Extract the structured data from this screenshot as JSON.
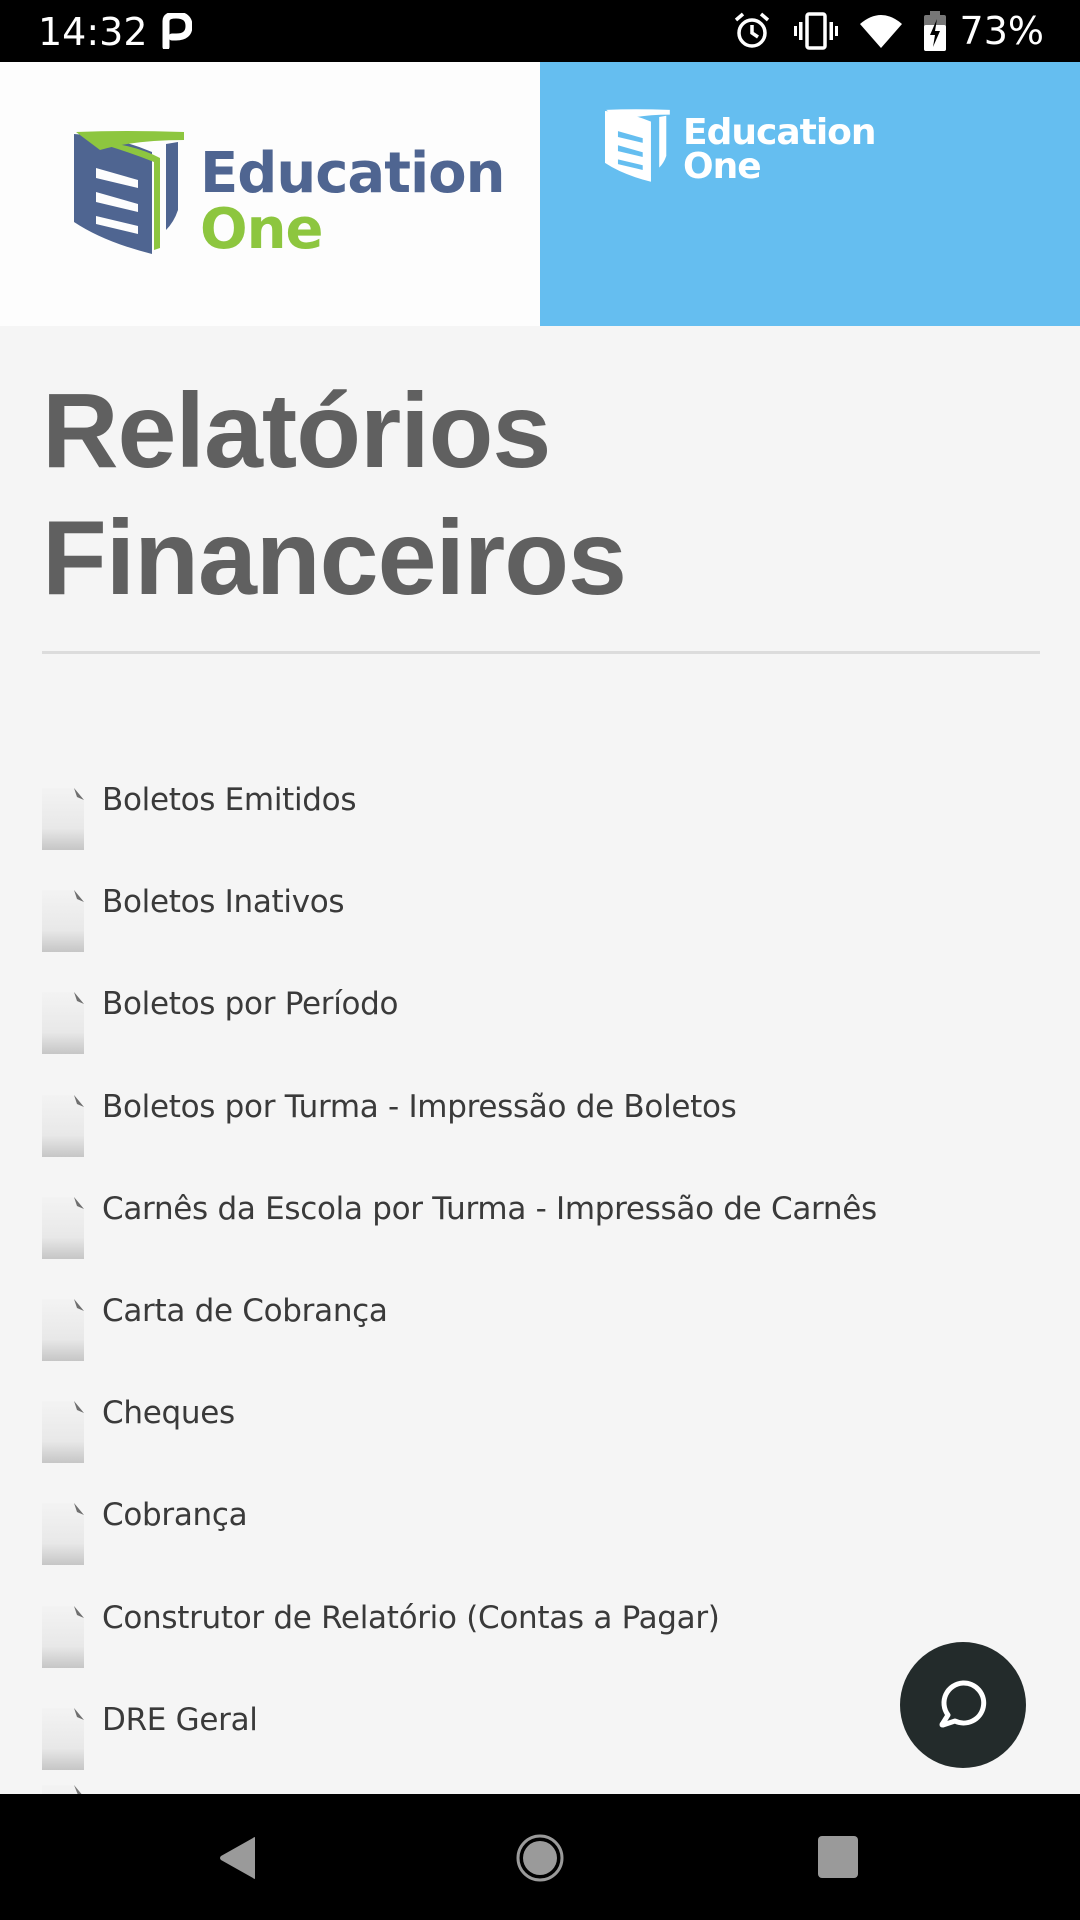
{
  "status_bar": {
    "time": "14:32",
    "notification_icons": [
      "parking-icon"
    ],
    "system_icons": [
      "alarm-icon",
      "vibrate-icon",
      "wifi-icon",
      "battery-charging-icon"
    ],
    "battery_percent": "73%"
  },
  "header": {
    "logo_left": {
      "line1": "Education",
      "line2": "One"
    },
    "logo_right": {
      "line1": "Education",
      "line2": "One"
    },
    "menu_icon": "hamburger-menu-icon",
    "colors": {
      "logo_blue": "#4f6591",
      "logo_green": "#8dc63f",
      "banner_blue": "#65bef0"
    }
  },
  "page": {
    "title_line1": "Relatórios",
    "title_line2": "Financeiros"
  },
  "reports": [
    {
      "label": "Boletos Emitidos",
      "icon": "file-icon"
    },
    {
      "label": "Boletos Inativos",
      "icon": "file-icon"
    },
    {
      "label": "Boletos por Período",
      "icon": "file-icon"
    },
    {
      "label": "Boletos por Turma - Impressão de Boletos",
      "icon": "file-icon"
    },
    {
      "label": "Carnês da Escola por Turma - Impressão de Carnês",
      "icon": "file-icon"
    },
    {
      "label": "Carta de Cobrança",
      "icon": "file-icon"
    },
    {
      "label": "Cheques",
      "icon": "file-icon"
    },
    {
      "label": "Cobrança",
      "icon": "file-icon"
    },
    {
      "label": "Construtor de Relatório (Contas a Pagar)",
      "icon": "file-icon"
    },
    {
      "label": "DRE Geral",
      "icon": "file-icon"
    }
  ],
  "chat_button": {
    "icon": "chat-bubble-icon"
  },
  "nav_bar": {
    "buttons": [
      "back",
      "home",
      "recents"
    ]
  }
}
